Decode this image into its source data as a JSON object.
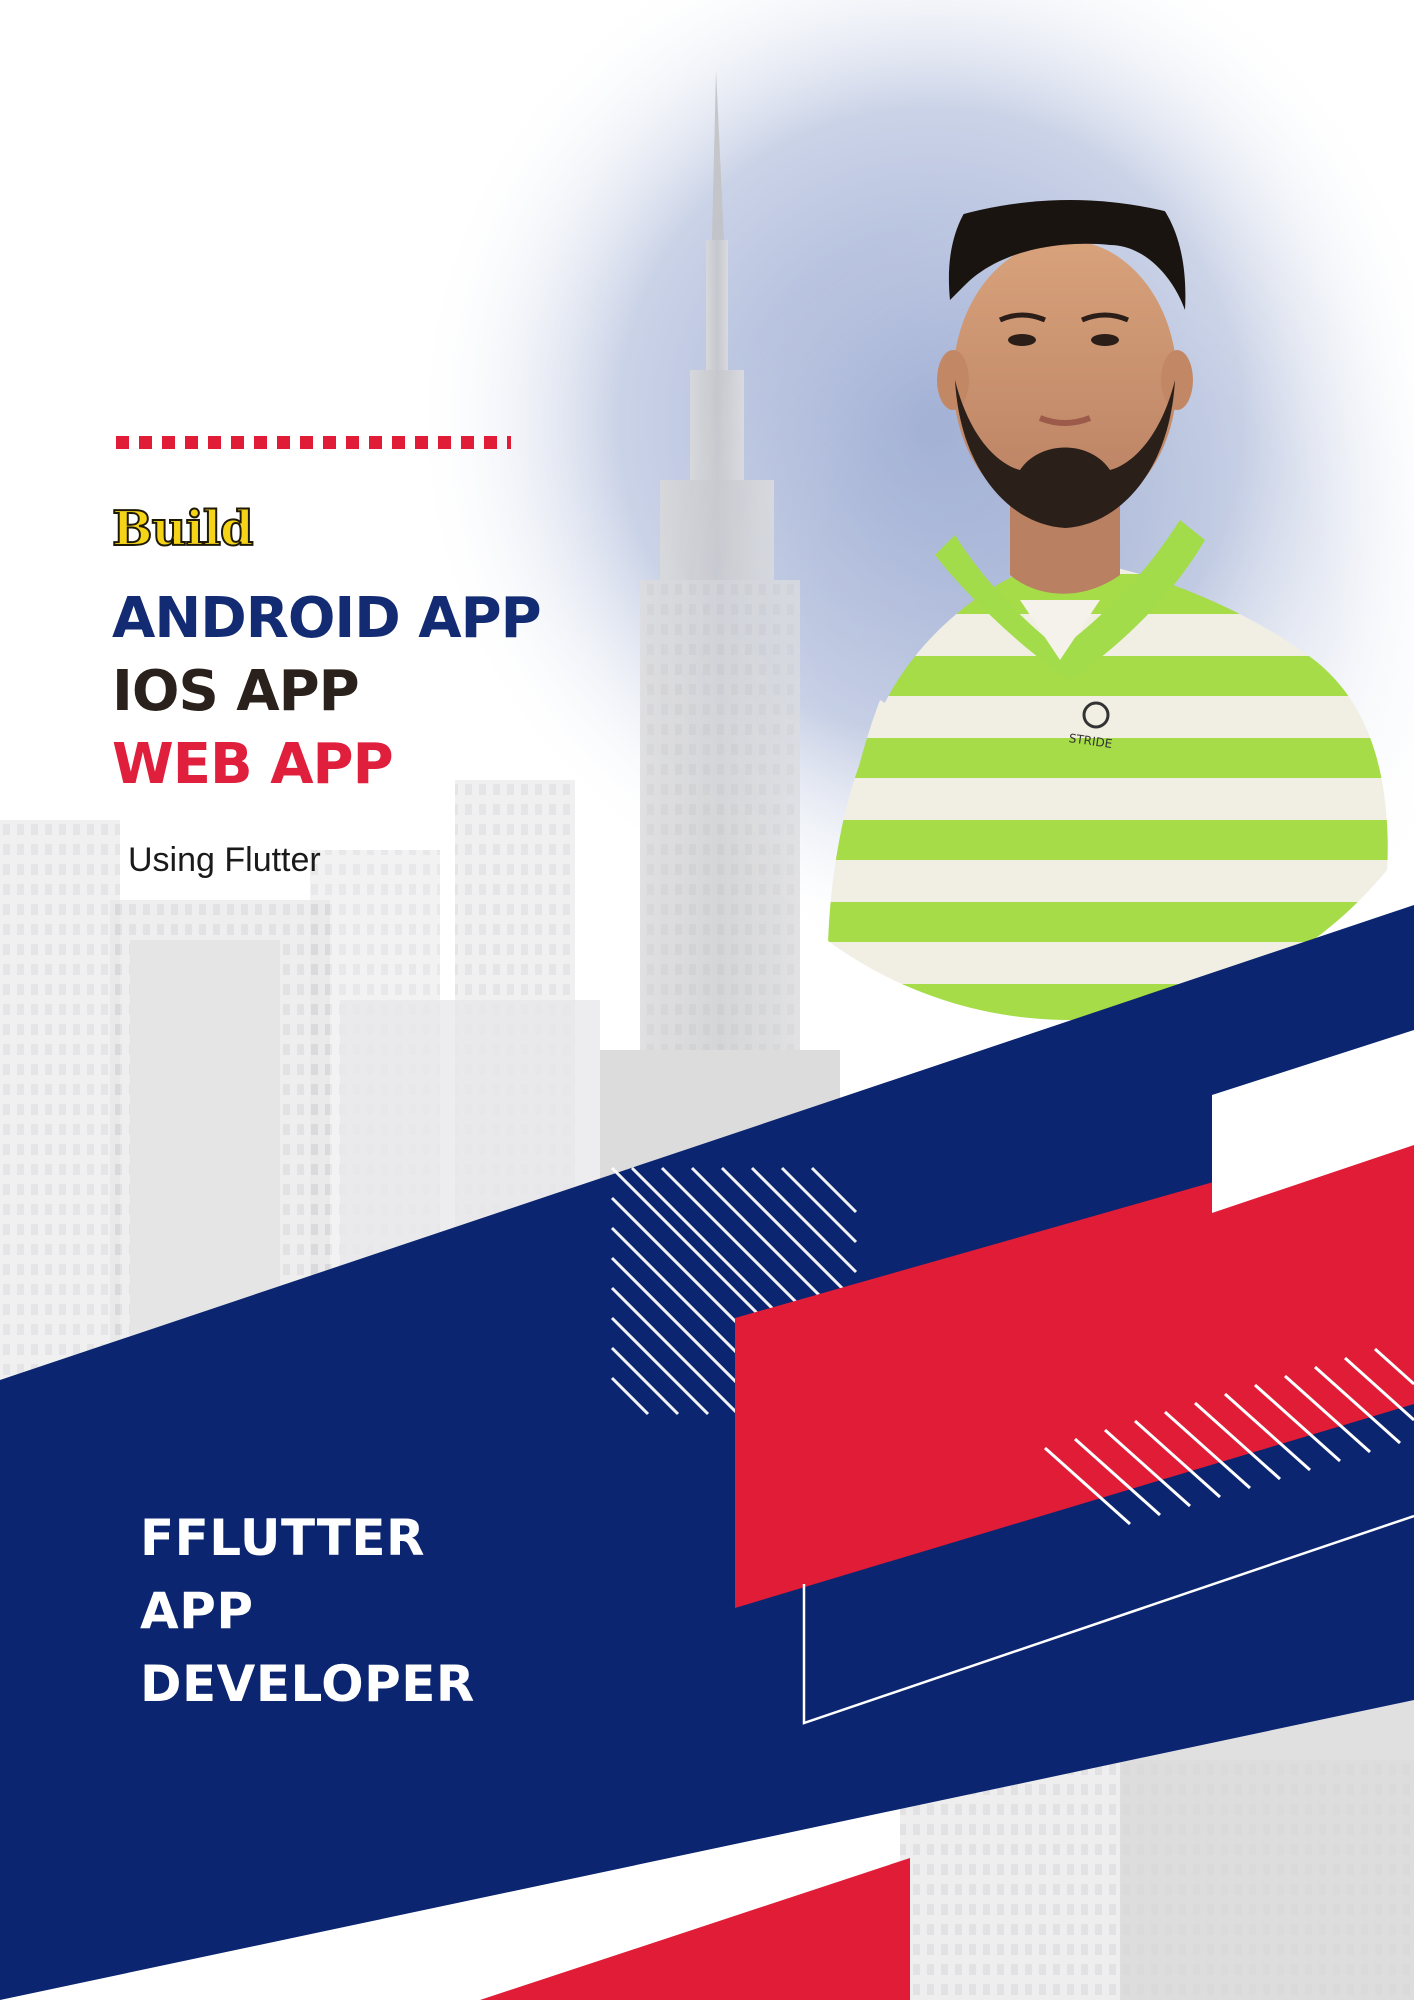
{
  "headline": {
    "lead": "Build",
    "platforms": [
      {
        "label": "ANDROID APP",
        "color": "#132b72"
      },
      {
        "label": "IOS APP",
        "color": "#2a211c"
      },
      {
        "label": "WEB APP",
        "color": "#e01f3d"
      }
    ],
    "subtitle": "Using Flutter"
  },
  "role": {
    "lines": [
      "FFLUTTER",
      "APP",
      "DEVELOPER"
    ]
  },
  "shirt_logo_text": "STRIDE",
  "colors": {
    "navy": "#0b2570",
    "red": "#e01c37",
    "yellow": "#f5d418",
    "shirt_green": "#a3dc4a",
    "white": "#ffffff"
  }
}
